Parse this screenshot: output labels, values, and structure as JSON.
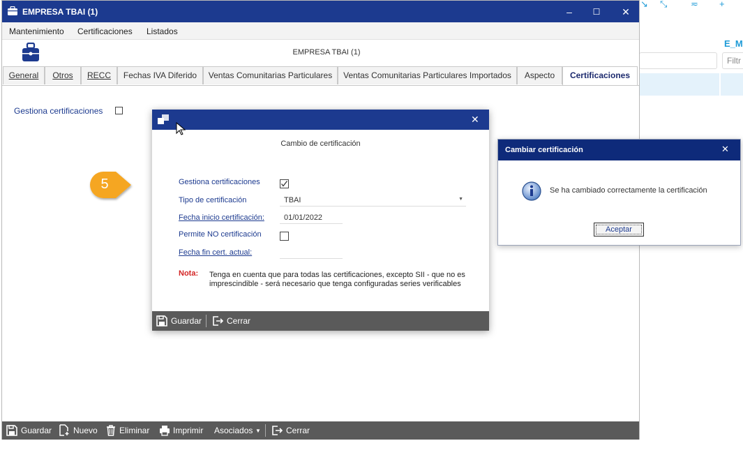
{
  "main_window": {
    "title": "EMPRESA TBAI (1)",
    "menu": [
      "Mantenimiento",
      "Certificaciones",
      "Listados"
    ],
    "header": "EMPRESA TBAI (1)",
    "tabs": [
      {
        "label": "General"
      },
      {
        "label": "Otros"
      },
      {
        "label": "RECC"
      },
      {
        "label": "Fechas IVA Diferido"
      },
      {
        "label": "Ventas Comunitarias Particulares"
      },
      {
        "label": "Ventas Comunitarias Particulares Importados"
      },
      {
        "label": "Aspecto"
      },
      {
        "label": "Certificaciones"
      }
    ],
    "active_tab": "Certificaciones",
    "gestiona_label": "Gestiona certificaciones",
    "gestiona_checked": false,
    "toolbar": {
      "save": "Guardar",
      "new": "Nuevo",
      "delete": "Eliminar",
      "print": "Imprimir",
      "associated": "Asociados",
      "close": "Cerrar"
    }
  },
  "dialog_cambio": {
    "subtitle": "Cambio de certificación",
    "gestiona_label": "Gestiona certificaciones",
    "gestiona_checked": true,
    "tipo_label": "Tipo de certificación",
    "tipo_value": "TBAI",
    "fecha_inicio_label": "Fecha inicio certificación:",
    "fecha_inicio_value": "01/01/2022",
    "permite_label": "Permite NO certificación",
    "permite_checked": false,
    "fecha_fin_label": "Fecha fin cert. actual:",
    "fecha_fin_value": "",
    "nota_label": "Nota:",
    "nota_text": "Tenga en cuenta que para todas las certificaciones, excepto SII - que no es imprescindible - será necesario que tenga configuradas series verificables",
    "toolbar": {
      "save": "Guardar",
      "close": "Cerrar"
    }
  },
  "dialog_info": {
    "title": "Cambiar certificación",
    "message": "Se ha cambiado correctamente la certificación",
    "ok": "Aceptar"
  },
  "callout": {
    "number": "5",
    "color": "#f5a623"
  },
  "background": {
    "label": "E_M",
    "filter_placeholder": "Filtr"
  },
  "colors": {
    "titlebar": "#1c3a8f",
    "toolbar": "#5a5a5a",
    "note": "#d32424",
    "accent": "#1e9bd7"
  }
}
